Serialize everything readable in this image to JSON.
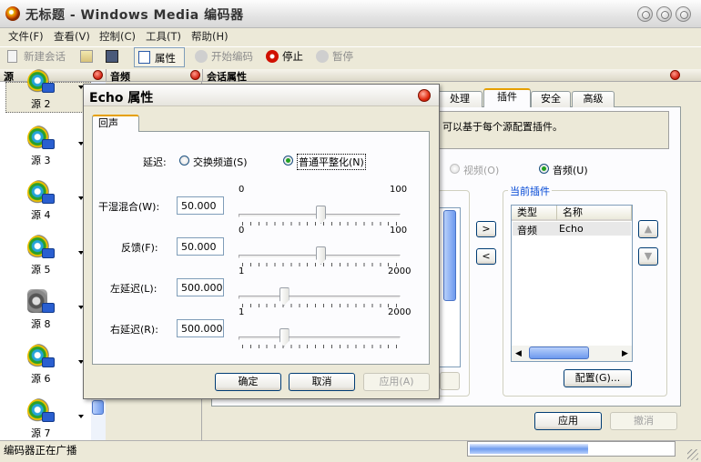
{
  "window": {
    "title": "无标题 - Windows Media 编码器"
  },
  "menu": [
    "文件(F)",
    "查看(V)",
    "控制(C)",
    "工具(T)",
    "帮助(H)"
  ],
  "toolbar": {
    "new_session": "新建会话",
    "properties": "属性",
    "start_encoding": "开始编码",
    "stop": "停止",
    "pause": "暂停"
  },
  "panes": {
    "source": "源",
    "audio": "音频",
    "session_props": "会话属性"
  },
  "sources": [
    {
      "label": "源 2",
      "icon": "media-source-icon"
    },
    {
      "label": "源 3",
      "icon": "media-source-icon"
    },
    {
      "label": "源 4",
      "icon": "media-source-icon"
    },
    {
      "label": "源 5",
      "icon": "media-source-icon"
    },
    {
      "label": "源 8",
      "icon": "camera-source-icon"
    },
    {
      "label": "源 6",
      "icon": "media-source-icon"
    },
    {
      "label": "源 7",
      "icon": "media-source-icon"
    }
  ],
  "session": {
    "tabs": [
      "处理",
      "插件",
      "安全",
      "高级"
    ],
    "active_tab": "插件",
    "description": "可以基于每个源配置插件。",
    "radio_video": "视频(O)",
    "radio_audio": "音频(U)",
    "current_plugins_title": "当前插件",
    "columns": [
      "类型",
      "名称"
    ],
    "plugins": [
      {
        "type": "音频",
        "name": "Echo"
      }
    ],
    "config_button": "配置(G)...",
    "apply_button": "应用",
    "cancel_button": "撤消"
  },
  "echo": {
    "title": "Echo 属性",
    "tab": "回声",
    "delay_label": "延迟:",
    "delay_options": [
      "交换频道(S)",
      "普通平整化(N)"
    ],
    "delay_selected": 1,
    "rows": [
      {
        "label": "干湿混合(W):",
        "value": "50.000",
        "min": "0",
        "max": "100",
        "level": 0.5
      },
      {
        "label": "反馈(F):",
        "value": "50.000",
        "min": "0",
        "max": "100",
        "level": 0.5
      },
      {
        "label": "左延迟(L):",
        "value": "500.000",
        "min": "1",
        "max": "2000",
        "level": 0.25
      },
      {
        "label": "右延迟(R):",
        "value": "500.000",
        "min": "1",
        "max": "2000",
        "level": 0.25
      }
    ],
    "ok": "确定",
    "cancel": "取消",
    "apply": "应用(A)"
  },
  "status": {
    "text": "编码器正在广播"
  },
  "colors": {
    "accent_tab": "#e6a000",
    "close_red": "#d02010",
    "progress": "#6f9bee"
  }
}
